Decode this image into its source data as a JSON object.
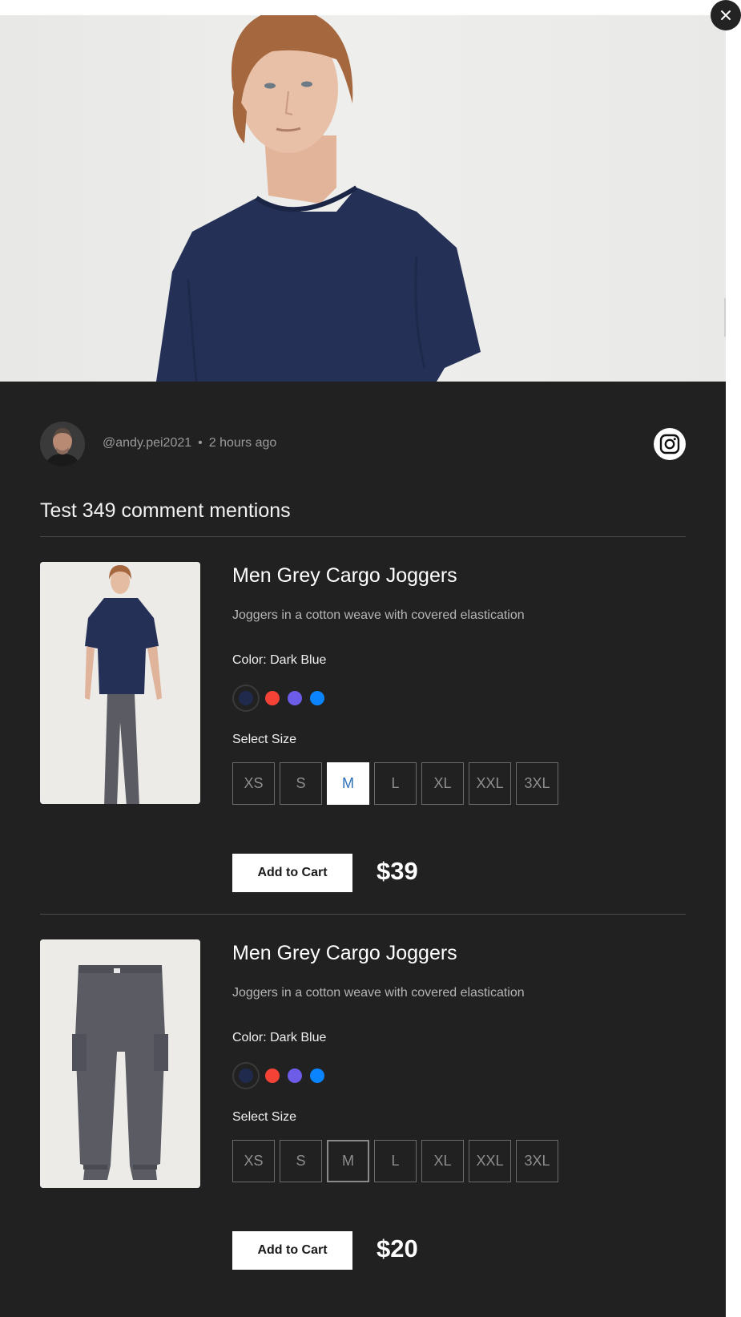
{
  "close": {
    "icon": "close-icon"
  },
  "post": {
    "username": "@andy.pei2021",
    "separator": "•",
    "time_ago": "2 hours ago",
    "caption": "Test 349 comment mentions",
    "social_icon": "instagram-icon"
  },
  "products": [
    {
      "title": "Men Grey Cargo Joggers",
      "description": "Joggers in a cotton weave with covered elastication",
      "color_label": "Color: Dark Blue",
      "colors": [
        "#1f2a4d",
        "#f44336",
        "#6c5ce7",
        "#0a84ff"
      ],
      "selected_color": "#1f2a4d",
      "size_label": "Select Size",
      "sizes": [
        "XS",
        "S",
        "M",
        "L",
        "XL",
        "XXL",
        "3XL"
      ],
      "selected_size": "M",
      "cart_label": "Add to Cart",
      "price": "$39"
    },
    {
      "title": "Men Grey Cargo Joggers",
      "description": "Joggers in a cotton weave with covered elastication",
      "color_label": "Color: Dark Blue",
      "colors": [
        "#1f2a4d",
        "#f44336",
        "#6c5ce7",
        "#0a84ff"
      ],
      "selected_color": "#1f2a4d",
      "size_label": "Select Size",
      "sizes": [
        "XS",
        "S",
        "M",
        "L",
        "XL",
        "XXL",
        "3XL"
      ],
      "selected_size": "M",
      "cart_label": "Add to Cart",
      "price": "$20"
    }
  ],
  "theme": {
    "panel": "#212121",
    "accent": "#2a6fb8",
    "shirt": "#1f2a4d",
    "pants": "#5b5c63"
  }
}
